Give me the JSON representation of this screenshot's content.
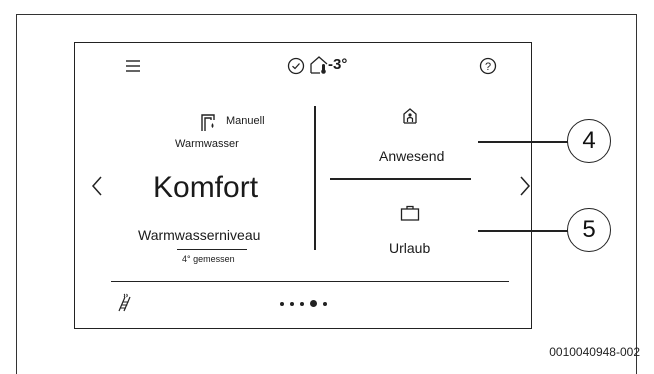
{
  "status_bar": {
    "menu_icon": "menu-icon",
    "check_icon": "check-circle-icon",
    "outdoor_icon": "house-thermometer-icon",
    "outdoor_temp": "-3°",
    "help_icon": "help-icon"
  },
  "hot_water": {
    "mode": "Manuell",
    "section_label": "Warmwasser",
    "level_value": "Komfort",
    "level_label": "Warmwasserniveau",
    "measured": "4° gemessen",
    "tap_icon": "water-tap-icon"
  },
  "presence": {
    "home_icon": "home-person-icon",
    "home_label": "Anwesend",
    "vacation_icon": "suitcase-icon",
    "vacation_label": "Urlaub"
  },
  "navigation": {
    "prev_icon": "chevron-left-icon",
    "next_icon": "chevron-right-icon",
    "page_dots": 5,
    "active_dot": 4
  },
  "footer": {
    "heating_icon": "heating-ladder-icon"
  },
  "callouts": {
    "home": "4",
    "vacation": "5"
  },
  "figure_ref": "0010040948-002"
}
